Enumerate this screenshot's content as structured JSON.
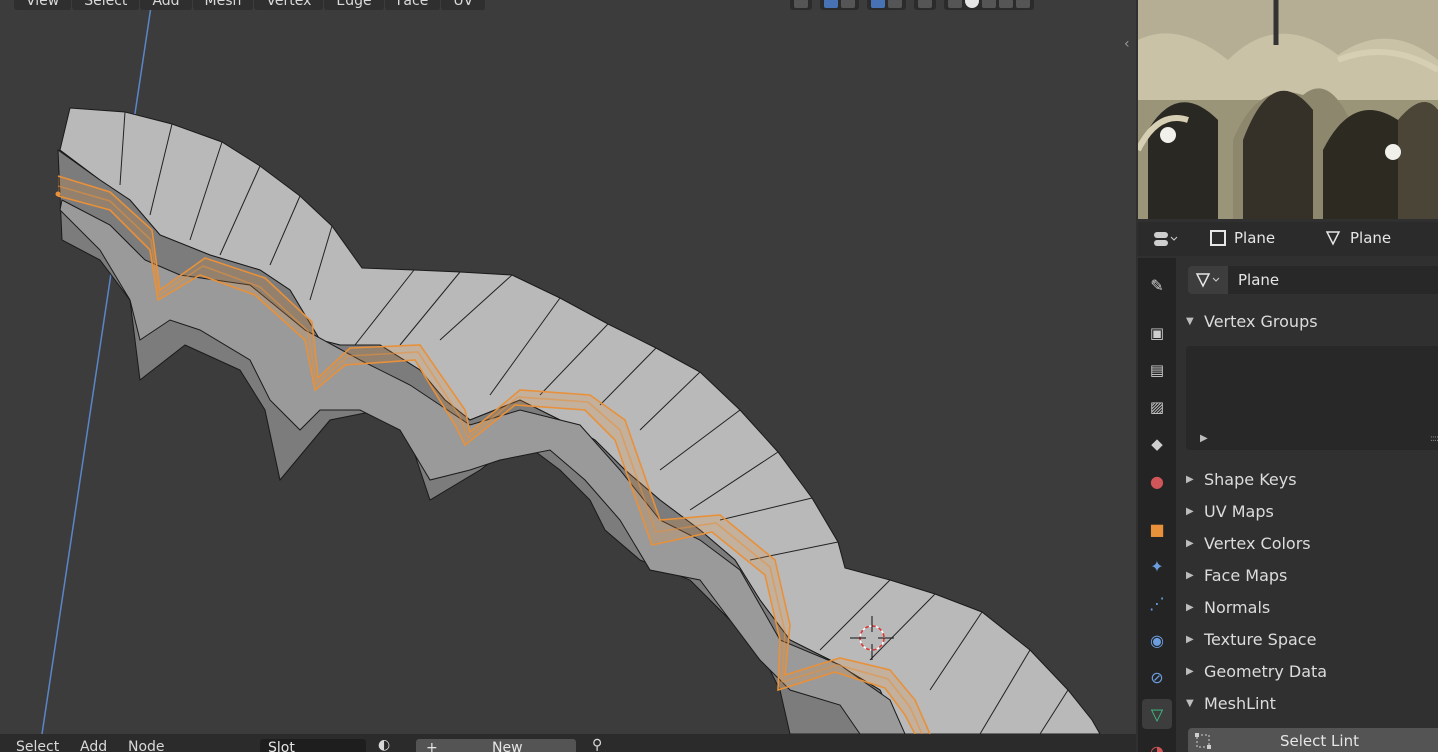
{
  "viewport": {
    "menu": [
      "View",
      "Select",
      "Add",
      "Mesh",
      "Vertex",
      "Edge",
      "Face",
      "UV"
    ],
    "collapse_icon": "chevron-left-icon"
  },
  "bottom_bar": {
    "select": "Select",
    "add": "Add",
    "node": "Node",
    "slot": "Slot",
    "new_button": "New"
  },
  "properties_header": {
    "object_name": "Plane",
    "mesh_name": "Plane"
  },
  "mesh_data": {
    "mesh_name": "Plane",
    "panels": [
      {
        "label": "Vertex Groups",
        "expanded": true
      },
      {
        "label": "Shape Keys",
        "expanded": false
      },
      {
        "label": "UV Maps",
        "expanded": false
      },
      {
        "label": "Vertex Colors",
        "expanded": false
      },
      {
        "label": "Face Maps",
        "expanded": false
      },
      {
        "label": "Normals",
        "expanded": false
      },
      {
        "label": "Texture Space",
        "expanded": false
      },
      {
        "label": "Geometry Data",
        "expanded": false
      },
      {
        "label": "MeshLint",
        "expanded": true
      }
    ],
    "select_lint_button": "Select Lint"
  },
  "tabs": [
    "tool",
    "render",
    "output",
    "view-layer",
    "scene",
    "world",
    "object",
    "modifiers",
    "particles",
    "physics",
    "constraints",
    "data",
    "material"
  ],
  "colors": {
    "accent_blue": "#4772b3",
    "selection_orange": "#e8913a",
    "mesh_face": "#b9b9b9",
    "viewport_bg": "#3c3c3c"
  }
}
